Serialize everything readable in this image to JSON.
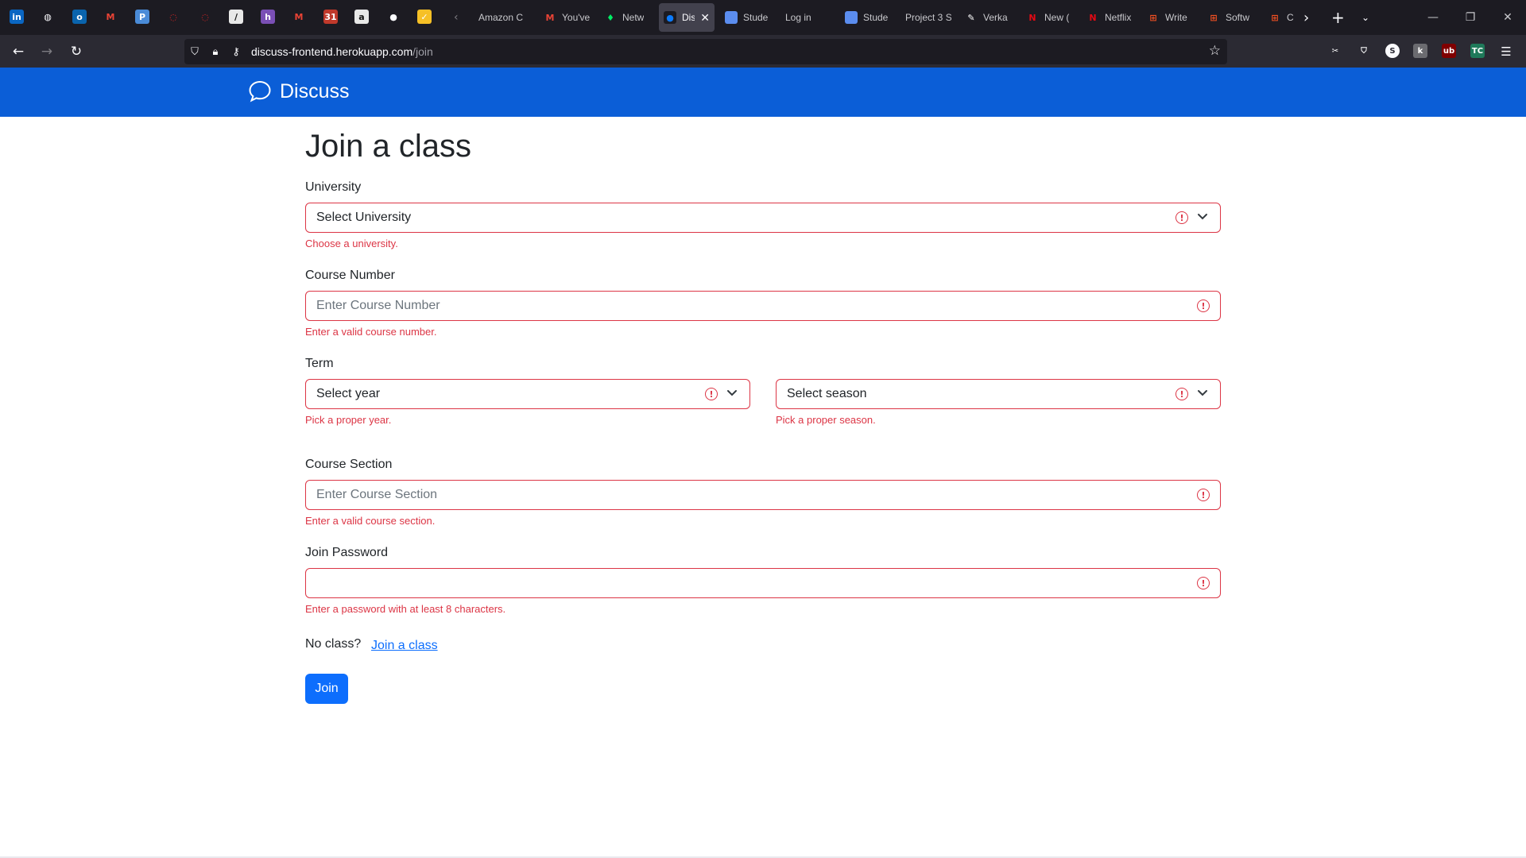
{
  "browser": {
    "pinned": [
      {
        "name": "linkedin-icon",
        "glyph": "in",
        "color": "#0a66c2"
      },
      {
        "name": "globe-icon",
        "glyph": "◍",
        "color": "#1c1b22"
      },
      {
        "name": "outlook-icon",
        "glyph": "o",
        "color": "#0a64ad"
      },
      {
        "name": "gmail-icon",
        "glyph": "M",
        "color": "#1c1b22"
      },
      {
        "name": "p-app-icon",
        "glyph": "P",
        "color": "#4a8bd8"
      },
      {
        "name": "red-circle-icon",
        "glyph": "◌",
        "color": "#1c1b22"
      },
      {
        "name": "red-circle-icon-2",
        "glyph": "◌",
        "color": "#1c1b22"
      },
      {
        "name": "slash-app-icon",
        "glyph": "∕",
        "color": "#e8e8e8"
      },
      {
        "name": "h-app-icon",
        "glyph": "h",
        "color": "#7a4fb5"
      },
      {
        "name": "gmail-icon-2",
        "glyph": "M",
        "color": "#1c1b22"
      },
      {
        "name": "calendar-badge-icon",
        "glyph": "31",
        "color": "#c0392b"
      },
      {
        "name": "amazon-icon",
        "glyph": "a",
        "color": "#e8e8e8"
      },
      {
        "name": "github-icon",
        "glyph": "●",
        "color": "#1c1b22"
      },
      {
        "name": "keep-icon",
        "glyph": "✓",
        "color": "#f6c026"
      }
    ],
    "tabs": [
      {
        "name": "tab-amazon",
        "title": "Amazon C",
        "fav": "",
        "favcolor": "#1c1b22"
      },
      {
        "name": "tab-gmail",
        "title": "You've",
        "fav": "M",
        "favcolor": "#1c1b22"
      },
      {
        "name": "tab-network",
        "title": "Netw",
        "fav": "♦",
        "favcolor": "#1c1b22"
      },
      {
        "name": "tab-discuss",
        "title": "Disc",
        "fav": "●",
        "favcolor": "#1c1b22"
      },
      {
        "name": "tab-student",
        "title": "Stude",
        "fav": "",
        "favcolor": "#5b8def"
      },
      {
        "name": "tab-login",
        "title": "Log in",
        "fav": "",
        "favcolor": "#1c1b22"
      },
      {
        "name": "tab-student-2",
        "title": "Stude",
        "fav": "",
        "favcolor": "#5b8def"
      },
      {
        "name": "tab-project3",
        "title": "Project 3 S",
        "fav": "",
        "favcolor": "#1c1b22"
      },
      {
        "name": "tab-verka",
        "title": "Verka",
        "fav": "✎",
        "favcolor": "#1c1b22"
      },
      {
        "name": "tab-netflix-new",
        "title": "New (",
        "fav": "N",
        "favcolor": "#1c1b22"
      },
      {
        "name": "tab-netflix",
        "title": "Netflix",
        "fav": "N",
        "favcolor": "#1c1b22"
      },
      {
        "name": "tab-write",
        "title": "Write",
        "fav": "⊞",
        "favcolor": "#1c1b22"
      },
      {
        "name": "tab-software",
        "title": "Softw",
        "fav": "⊞",
        "favcolor": "#1c1b22"
      },
      {
        "name": "tab-ca",
        "title": "Ca",
        "fav": "⊞",
        "favcolor": "#1c1b22"
      }
    ],
    "url_host": "discuss-frontend.herokuapp.com",
    "url_path": "/join",
    "extensions": [
      {
        "name": "screenshot-ext-icon",
        "glyph": "✂",
        "color": "#2b2a33"
      },
      {
        "name": "pocket-icon",
        "glyph": "⛉",
        "color": "#2b2a33"
      },
      {
        "name": "s-ext-icon",
        "glyph": "S",
        "color": "#2b2a33"
      },
      {
        "name": "k-ext-icon",
        "glyph": "k",
        "color": "#6b6b70"
      },
      {
        "name": "ublock-icon",
        "glyph": "ub",
        "color": "#800000"
      },
      {
        "name": "tc-ext-icon",
        "glyph": "TC",
        "color": "#1f7a5a"
      }
    ]
  },
  "app": {
    "brand": "Discuss"
  },
  "form": {
    "title": "Join a class",
    "university": {
      "label": "University",
      "value": "Select University",
      "feedback": "Choose a university."
    },
    "course_number": {
      "label": "Course Number",
      "placeholder": "Enter Course Number",
      "feedback": "Enter a valid course number."
    },
    "term": {
      "label": "Term",
      "year_value": "Select year",
      "year_feedback": "Pick a proper year.",
      "season_value": "Select season",
      "season_feedback": "Pick a proper season."
    },
    "course_section": {
      "label": "Course Section",
      "placeholder": "Enter Course Section",
      "feedback": "Enter a valid course section."
    },
    "join_password": {
      "label": "Join Password",
      "placeholder": "",
      "feedback": "Enter a password with at least 8 characters."
    },
    "no_class_text": "No class?",
    "join_link": "Join a class",
    "join_button": "Join"
  },
  "colors": {
    "header_blue": "#0b5ed7",
    "error_red": "#dc3545",
    "primary_blue": "#0d6efd"
  }
}
